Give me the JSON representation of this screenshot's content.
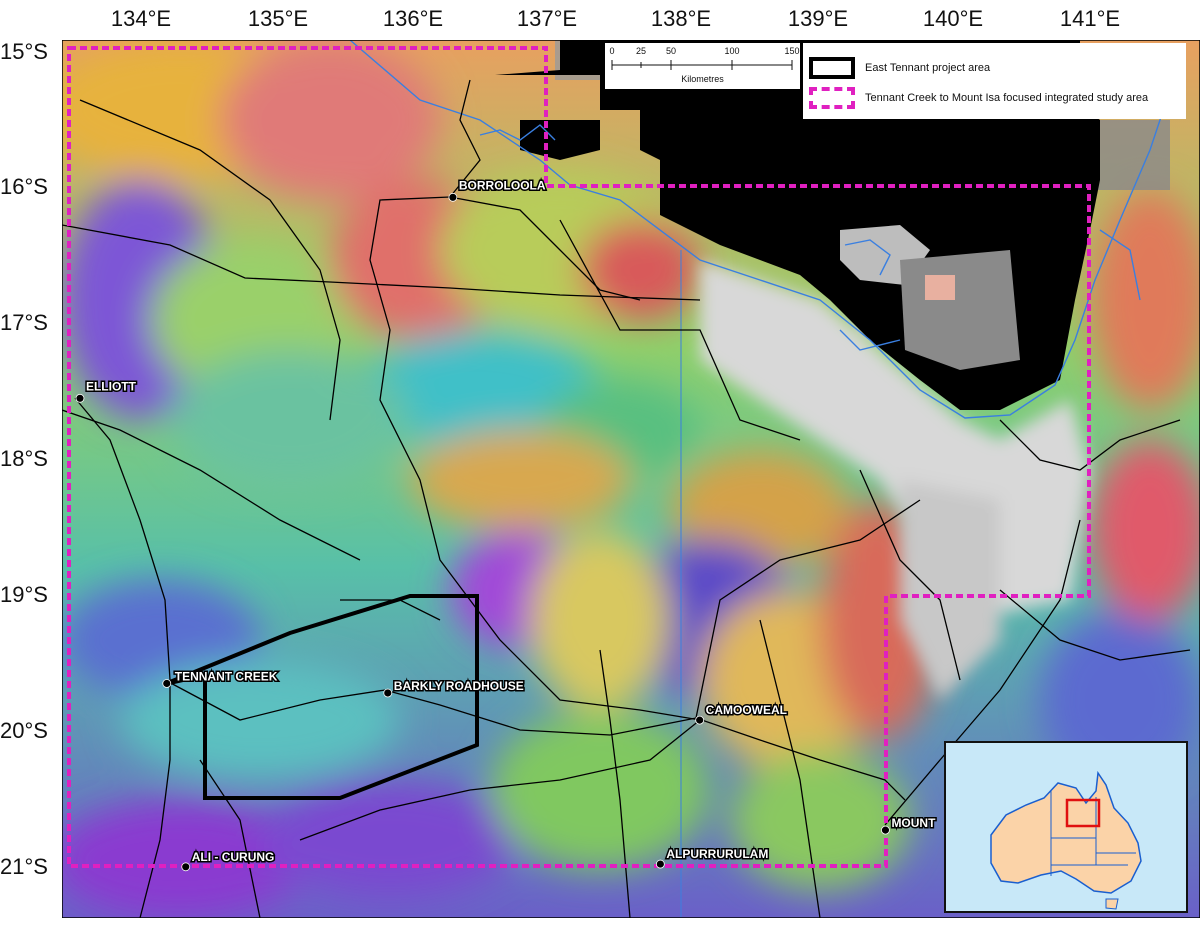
{
  "axes": {
    "longitude_labels": [
      "134°E",
      "135°E",
      "136°E",
      "137°E",
      "138°E",
      "139°E",
      "140°E",
      "141°E"
    ],
    "latitude_labels": [
      "15°S",
      "16°S",
      "17°S",
      "18°S",
      "19°S",
      "20°S",
      "21°S"
    ]
  },
  "places": [
    {
      "name": "BORROLOOLA",
      "lon": 136.3,
      "lat": -16.07
    },
    {
      "name": "ELLIOTT",
      "lon": 133.55,
      "lat": -17.55
    },
    {
      "name": "TENNANT CREEK",
      "lon": 134.19,
      "lat": -19.65
    },
    {
      "name": "BARKLY ROADHOUSE",
      "lon": 135.82,
      "lat": -19.72
    },
    {
      "name": "CAMOOWEAL",
      "lon": 138.12,
      "lat": -19.92
    },
    {
      "name": "MOUNT",
      "lon": 139.49,
      "lat": -20.73
    },
    {
      "name": "ALI - CURUNG",
      "lon": 134.33,
      "lat": -21.0
    },
    {
      "name": "ALPURRURULAM",
      "lon": 137.83,
      "lat": -20.98
    }
  ],
  "scale_bar": {
    "ticks": [
      "0",
      "25",
      "50",
      "100",
      "150"
    ],
    "unit": "Kilometres"
  },
  "legend": {
    "items": [
      {
        "label": "East Tennant project area",
        "color": "#000000",
        "style": "solid"
      },
      {
        "label": "Tennant Creek to Mount Isa focused integrated study area",
        "color": "#e020c0",
        "style": "dashed"
      }
    ]
  },
  "colors": {
    "project_area": "#000000",
    "study_area": "#e020c0",
    "sea": "#000000",
    "coastline": "#3a7fe0",
    "roads": "#000000",
    "inset_highlight": "#e01010",
    "inset_land": "#fbd3a8",
    "inset_sea": "#c8e8f8"
  }
}
